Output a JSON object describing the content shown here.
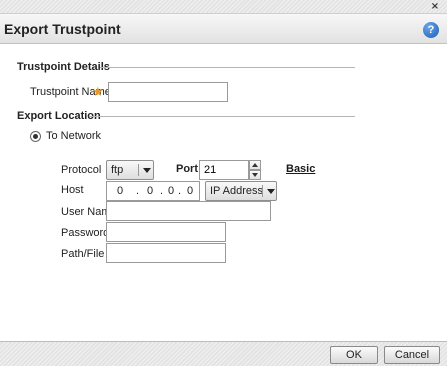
{
  "window": {
    "title": "Export Trustpoint",
    "close_glyph": "×",
    "help_glyph": "?"
  },
  "trustpoint_details": {
    "heading": "Trustpoint Details",
    "name_label": "Trustpoint Name",
    "name_value": "",
    "required_mark": "★"
  },
  "export_location": {
    "heading": "Export Location",
    "to_network_label": "To Network",
    "to_network_selected": true
  },
  "network": {
    "protocol_label": "Protocol",
    "protocol_value": "ftp",
    "port_label": "Port",
    "port_value": "21",
    "basic_link": "Basic",
    "host_label": "Host",
    "host_segments": [
      "0",
      "0",
      "0",
      "0"
    ],
    "host_dot": ".",
    "host_type_value": "IP Address",
    "user_name_label": "User Name",
    "user_name_value": "",
    "password_label": "Password",
    "password_value": "",
    "path_label": "Path/File",
    "path_value": ""
  },
  "footer": {
    "ok_label": "OK",
    "cancel_label": "Cancel"
  },
  "icons": {
    "close": "close-icon",
    "help": "help-icon",
    "required": "required-star-icon",
    "dropdown": "chevron-down-icon"
  },
  "colors": {
    "required_star": "#f29a1a",
    "help_icon": "#1a5fb8"
  }
}
